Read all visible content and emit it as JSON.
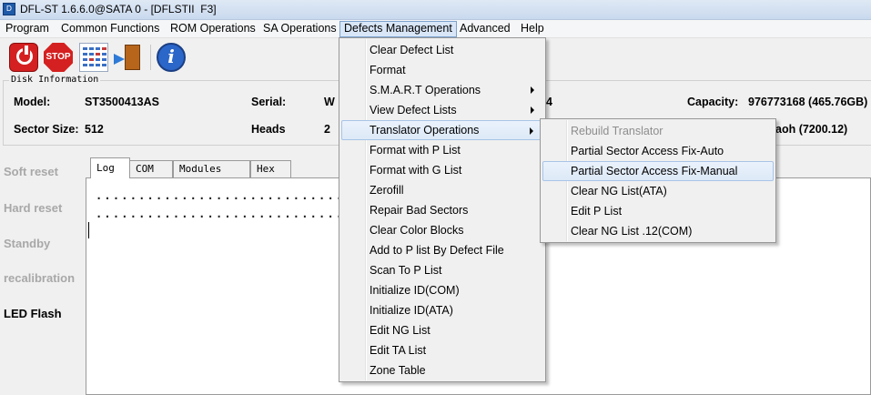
{
  "window": {
    "title": "DFL-ST 1.6.6.0@SATA 0 - [DFLSTII  F3]"
  },
  "menubar": {
    "items": [
      "Program",
      "Common Functions",
      "ROM Operations",
      "SA Operations",
      "Defects Management",
      "Advanced",
      "Help"
    ]
  },
  "toolbar": {
    "stop_label": "STOP",
    "info_label": "i"
  },
  "disk_info": {
    "group_label": "Disk Information",
    "model_label": "Model:",
    "model_value": "ST3500413AS",
    "serial_label": "Serial:",
    "serial_partial": "W",
    "serial_tail_partial": "4",
    "capacity_label": "Capacity:",
    "capacity_value": "976773168 (465.76GB)",
    "sector_size_label": "Sector Size:",
    "sector_size_value": "512",
    "heads_label": "Heads",
    "heads_value": "2",
    "firmware_partial": "aoh (7200.12)"
  },
  "side_buttons": [
    {
      "label": "Soft reset",
      "enabled": false
    },
    {
      "label": "Hard reset",
      "enabled": false
    },
    {
      "label": "Standby",
      "enabled": false
    },
    {
      "label": "recalibration",
      "enabled": false
    },
    {
      "label": "LED Flash",
      "enabled": true
    }
  ],
  "tabs": [
    "Log",
    "COM",
    "Modules List",
    "Hex"
  ],
  "log": {
    "lines": [
      "..................................................",
      ".................................................."
    ]
  },
  "defects_menu": {
    "items": [
      {
        "label": "Clear Defect List",
        "submenu": false
      },
      {
        "label": "Format",
        "submenu": false
      },
      {
        "label": "S.M.A.R.T Operations",
        "submenu": true
      },
      {
        "label": "View Defect Lists",
        "submenu": true
      },
      {
        "label": "Translator Operations",
        "submenu": true,
        "highlighted": true
      },
      {
        "label": "Format with P List",
        "submenu": false
      },
      {
        "label": "Format with G List",
        "submenu": false
      },
      {
        "label": "Zerofill",
        "submenu": false
      },
      {
        "label": "Repair Bad Sectors",
        "submenu": false
      },
      {
        "label": "Clear Color Blocks",
        "submenu": false
      },
      {
        "label": "Add to P list By Defect File",
        "submenu": false
      },
      {
        "label": "Scan To P List",
        "submenu": false
      },
      {
        "label": "Initialize ID(COM)",
        "submenu": false
      },
      {
        "label": "Initialize ID(ATA)",
        "submenu": false
      },
      {
        "label": "Edit NG List",
        "submenu": false
      },
      {
        "label": "Edit TA List",
        "submenu": false
      },
      {
        "label": "Zone Table",
        "submenu": false
      }
    ]
  },
  "translator_submenu": {
    "items": [
      {
        "label": "Rebuild Translator",
        "disabled": true
      },
      {
        "label": "Partial Sector Access Fix-Auto"
      },
      {
        "label": "Partial Sector Access Fix-Manual",
        "highlighted": true
      },
      {
        "label": "Clear NG List(ATA)"
      },
      {
        "label": "Edit P List"
      },
      {
        "label": "Clear NG List .12(COM)"
      }
    ]
  }
}
